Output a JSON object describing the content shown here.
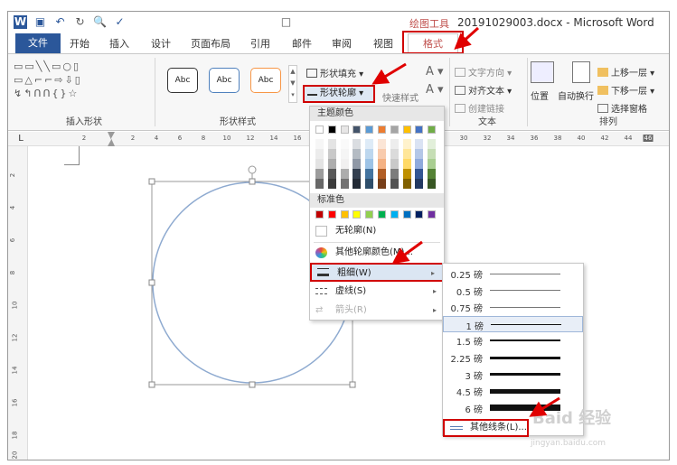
{
  "titlebar": {
    "context_label": "绘图工具",
    "title": "20191029003.docx - Microsoft Word",
    "qat_icons": [
      "word-logo-icon",
      "save-icon",
      "undo-icon",
      "redo-icon",
      "print-preview-icon",
      "spelling-icon",
      "new-icon"
    ]
  },
  "tabs": {
    "file": "文件",
    "items": [
      "开始",
      "插入",
      "设计",
      "页面布局",
      "引用",
      "邮件",
      "审阅",
      "视图"
    ],
    "format": "格式"
  },
  "ribbon": {
    "insert_shapes_label": "插入形状",
    "shape_styles_label": "形状样式",
    "style_sample": "Abc",
    "fill_label": "形状填充",
    "outline_label": "形状轮廓",
    "quick_styles_label": "快速样式",
    "text_direction": "文字方向",
    "align_text": "对齐文本",
    "create_link": "创建链接",
    "text_group_label": "文本",
    "position": "位置",
    "wrap_text": "自动换行",
    "bring_forward": "上移一层",
    "send_backward": "下移一层",
    "selection_pane": "选择窗格",
    "arrange_label": "排列",
    "style_colors": [
      "#ffffff",
      "#4f81bd",
      "#f79646"
    ]
  },
  "ruler": {
    "corner": "L",
    "marks": [
      "2",
      "2",
      "4",
      "6",
      "8",
      "10",
      "12",
      "14",
      "16",
      "28",
      "30",
      "32",
      "34",
      "36",
      "38",
      "40",
      "42",
      "44",
      "46"
    ],
    "vertical_marks": [
      "2",
      "4",
      "6",
      "8",
      "10",
      "12",
      "14",
      "16",
      "18",
      "20"
    ]
  },
  "outline_menu": {
    "theme_colors_header": "主题颜色",
    "standard_colors_header": "标准色",
    "no_outline": "无轮廓(N)",
    "more_colors": "其他轮廓颜色(M)...",
    "weight": "粗细(W)",
    "dashes": "虚线(S)",
    "arrows": "箭头(R)",
    "theme_top_row": [
      "#ffffff",
      "#000000",
      "#e7e6e6",
      "#44546a",
      "#5b9bd5",
      "#ed7d31",
      "#a5a5a5",
      "#ffc000",
      "#4472c4",
      "#70ad47"
    ],
    "standard_colors": [
      "#c00000",
      "#ff0000",
      "#ffc000",
      "#ffff00",
      "#92d050",
      "#00b050",
      "#00b0f0",
      "#0070c0",
      "#002060",
      "#7030a0"
    ]
  },
  "weight_menu": {
    "items": [
      {
        "label": "0.25 磅",
        "weight": 0.25
      },
      {
        "label": "0.5 磅",
        "weight": 0.5
      },
      {
        "label": "0.75 磅",
        "weight": 0.75
      },
      {
        "label": "1 磅",
        "weight": 1
      },
      {
        "label": "1.5 磅",
        "weight": 1.5
      },
      {
        "label": "2.25 磅",
        "weight": 2.25
      },
      {
        "label": "3 磅",
        "weight": 3
      },
      {
        "label": "4.5 磅",
        "weight": 4.5
      },
      {
        "label": "6 磅",
        "weight": 6
      }
    ],
    "selected": "1 磅",
    "more_lines": "其他线条(L)..."
  },
  "watermark": {
    "text": "Baid 经验",
    "sub": "jingyan.baidu.com"
  }
}
